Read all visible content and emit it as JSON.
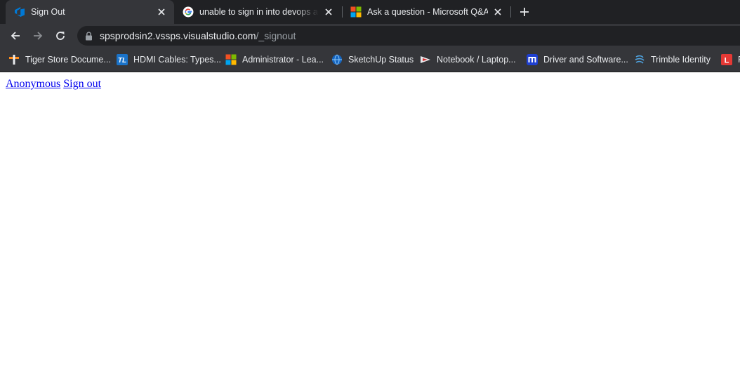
{
  "tabs": [
    {
      "title": "Sign Out",
      "active": true
    },
    {
      "title": "unable to sign in into devops account",
      "active": false
    },
    {
      "title": "Ask a question - Microsoft Q&A",
      "active": false
    }
  ],
  "address_bar": {
    "host": "spsprodsin2.vssps.visualstudio.com",
    "path": "/_signout"
  },
  "bookmarks": [
    {
      "label": "Tiger Store Docume..."
    },
    {
      "label": "HDMI Cables: Types..."
    },
    {
      "label": "Administrator - Lea..."
    },
    {
      "label": "SketchUp Status"
    },
    {
      "label": "Notebook / Laptop..."
    },
    {
      "label": "Driver and Software..."
    },
    {
      "label": "Trimble Identity"
    },
    {
      "label": "P"
    }
  ],
  "page": {
    "links": [
      {
        "label": "Anonymous"
      },
      {
        "label": "Sign out"
      }
    ]
  },
  "colors": {
    "tab_bar": "#202124",
    "toolbar": "#35363a",
    "link": "#0000ee",
    "azure_devops_blue": "#0078d4"
  }
}
